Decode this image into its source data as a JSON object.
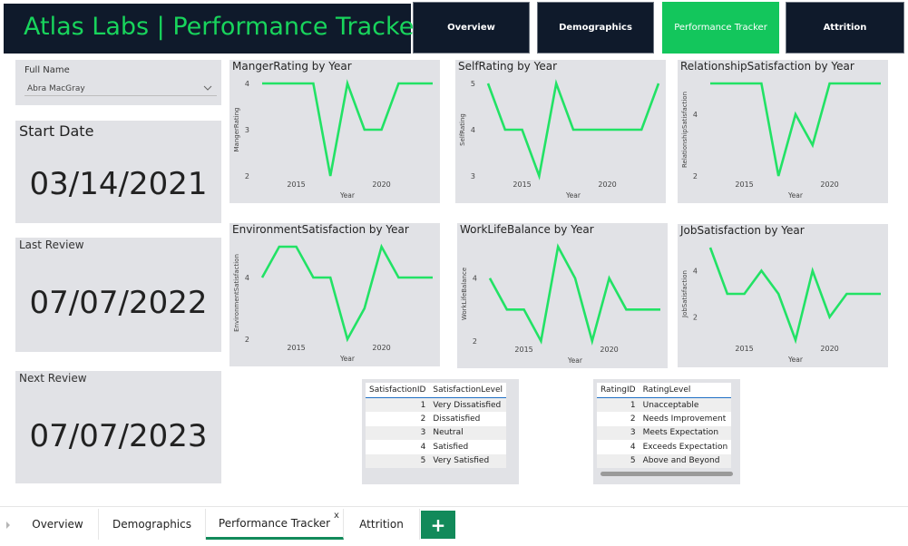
{
  "header": {
    "title": "Atlas Labs | Performance Tracker"
  },
  "nav": [
    {
      "label": "Overview"
    },
    {
      "label": "Demographics"
    },
    {
      "label": "Performance Tracker"
    },
    {
      "label": "Attrition"
    }
  ],
  "filter": {
    "label": "Full Name",
    "value": "Abra MacGray"
  },
  "dates": {
    "start_label": "Start Date",
    "start_value": "03/14/2021",
    "last_label": "Last Review",
    "last_value": "07/07/2022",
    "next_label": "Next Review",
    "next_value": "07/07/2023"
  },
  "colors": {
    "line": "#22e265",
    "accent": "#13c65c",
    "header_bg": "#0f1a2b"
  },
  "chart_data": [
    {
      "type": "line",
      "title": "MangerRating by Year",
      "xlabel": "Year",
      "ylabel": "MangerRating",
      "xticks": [
        2015,
        2020
      ],
      "yticks": [
        2,
        3,
        4
      ],
      "ylim": [
        2,
        4
      ],
      "xlim": [
        2013,
        2023
      ],
      "x": [
        2013,
        2014,
        2015,
        2016,
        2017,
        2018,
        2019,
        2020,
        2021,
        2022,
        2023
      ],
      "values": [
        4,
        4,
        4,
        4,
        2,
        4,
        3,
        3,
        4,
        4,
        4
      ]
    },
    {
      "type": "line",
      "title": "SelfRating by Year",
      "xlabel": "Year",
      "ylabel": "SelfRating",
      "xticks": [
        2015,
        2020
      ],
      "yticks": [
        3,
        4,
        5
      ],
      "ylim": [
        3,
        5
      ],
      "xlim": [
        2013,
        2023
      ],
      "x": [
        2013,
        2014,
        2015,
        2016,
        2017,
        2018,
        2019,
        2020,
        2021,
        2022,
        2023
      ],
      "values": [
        5,
        4,
        4,
        3,
        5,
        4,
        4,
        4,
        4,
        4,
        5
      ]
    },
    {
      "type": "line",
      "title": "RelationshipSatisfaction by Year",
      "xlabel": "Year",
      "ylabel": "RelationshipSatisfaction",
      "xticks": [
        2015,
        2020
      ],
      "yticks": [
        2,
        4
      ],
      "ylim": [
        2,
        5
      ],
      "xlim": [
        2013,
        2023
      ],
      "x": [
        2013,
        2014,
        2015,
        2016,
        2017,
        2018,
        2019,
        2020,
        2021,
        2022,
        2023
      ],
      "values": [
        5,
        5,
        5,
        5,
        2,
        4,
        3,
        5,
        5,
        5,
        5
      ]
    },
    {
      "type": "line",
      "title": "EnvironmentSatisfaction by Year",
      "xlabel": "Year",
      "ylabel": "EnvironmentSatisfaction",
      "xticks": [
        2015,
        2020
      ],
      "yticks": [
        2,
        4
      ],
      "ylim": [
        2,
        5
      ],
      "xlim": [
        2013,
        2023
      ],
      "x": [
        2013,
        2014,
        2015,
        2016,
        2017,
        2018,
        2019,
        2020,
        2021,
        2022,
        2023
      ],
      "values": [
        4,
        5,
        5,
        4,
        4,
        2,
        3,
        5,
        4,
        4,
        4
      ]
    },
    {
      "type": "line",
      "title": "WorkLifeBalance by Year",
      "xlabel": "Year",
      "ylabel": "WorkLifeBalance",
      "xticks": [
        2015,
        2020
      ],
      "yticks": [
        2,
        4
      ],
      "ylim": [
        2,
        5
      ],
      "xlim": [
        2013,
        2023
      ],
      "x": [
        2013,
        2014,
        2015,
        2016,
        2017,
        2018,
        2019,
        2020,
        2021,
        2022,
        2023
      ],
      "values": [
        4,
        3,
        3,
        2,
        5,
        4,
        2,
        4,
        3,
        3,
        3
      ]
    },
    {
      "type": "line",
      "title": "JobSatisfaction by Year",
      "xlabel": "Year",
      "ylabel": "JobSatisfaction",
      "xticks": [
        2015,
        2020
      ],
      "yticks": [
        2,
        4
      ],
      "ylim": [
        1,
        5
      ],
      "xlim": [
        2013,
        2023
      ],
      "x": [
        2013,
        2014,
        2015,
        2016,
        2017,
        2018,
        2019,
        2020,
        2021,
        2022,
        2023
      ],
      "values": [
        5,
        3,
        3,
        4,
        3,
        1,
        4,
        2,
        3,
        3,
        3
      ]
    }
  ],
  "satisfaction_table": {
    "headers": [
      "SatisfactionID",
      "SatisfactionLevel"
    ],
    "rows": [
      [
        "1",
        "Very Dissatisfied"
      ],
      [
        "2",
        "Dissatisfied"
      ],
      [
        "3",
        "Neutral"
      ],
      [
        "4",
        "Satisfied"
      ],
      [
        "5",
        "Very Satisfied"
      ]
    ]
  },
  "rating_table": {
    "headers": [
      "RatingID",
      "RatingLevel"
    ],
    "rows": [
      [
        "1",
        "Unacceptable"
      ],
      [
        "2",
        "Needs Improvement"
      ],
      [
        "3",
        "Meets Expectation"
      ],
      [
        "4",
        "Exceeds Expectation"
      ],
      [
        "5",
        "Above and Beyond"
      ]
    ]
  },
  "tabs": [
    {
      "label": "Overview"
    },
    {
      "label": "Demographics"
    },
    {
      "label": "Performance Tracker"
    },
    {
      "label": "Attrition"
    }
  ],
  "tab_close_glyph": "x",
  "add_tab_glyph": "+"
}
